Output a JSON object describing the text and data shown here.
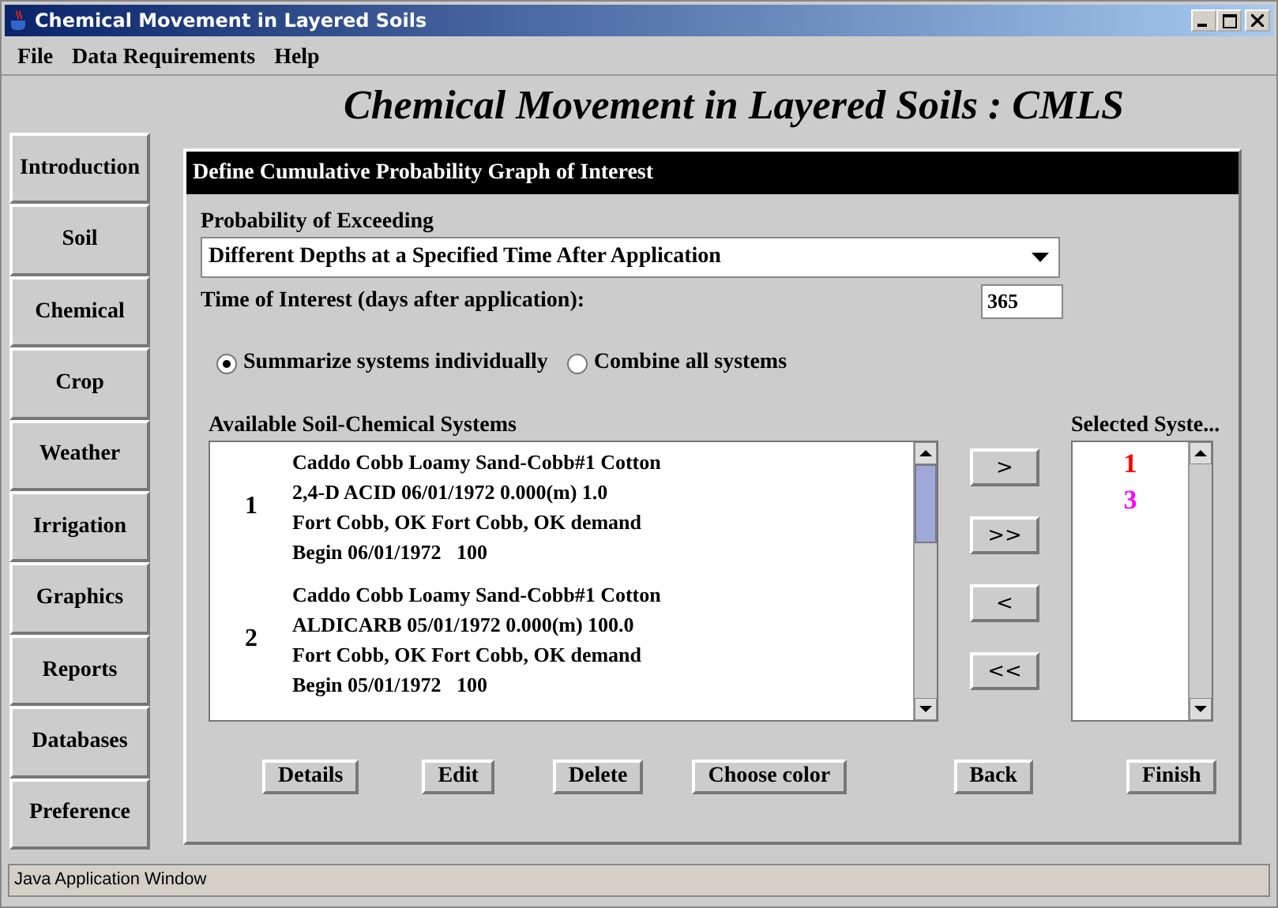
{
  "window": {
    "title": "Chemical Movement in Layered Soils"
  },
  "menu": [
    "File",
    "Data Requirements",
    "Help"
  ],
  "heading": "Chemical Movement in Layered Soils : CMLS",
  "sidebar": {
    "items": [
      "Introduction",
      "Soil",
      "Chemical",
      "Crop",
      "Weather",
      "Irrigation",
      "Graphics",
      "Reports",
      "Databases",
      "Preference"
    ]
  },
  "panel": {
    "title": "Define Cumulative Probability Graph of Interest",
    "probability_label": "Probability of Exceeding",
    "probability_dropdown": {
      "value": "Different Depths at a Specified Time After Application"
    },
    "time_label": "Time of Interest (days after application):",
    "time_field": {
      "value": "365"
    },
    "radios": [
      {
        "label": "Summarize systems individually",
        "selected": true
      },
      {
        "label": "Combine all systems",
        "selected": false
      }
    ],
    "available_label": "Available Soil-Chemical Systems",
    "available": [
      {
        "number": "1",
        "lines": [
          "Caddo Cobb Loamy Sand-Cobb#1 Cotton",
          "2,4-D ACID 06/01/1972 0.000(m) 1.0",
          "Fort Cobb, OK Fort Cobb, OK demand",
          "Begin 06/01/1972   100"
        ]
      },
      {
        "number": "2",
        "lines": [
          "Caddo Cobb Loamy Sand-Cobb#1 Cotton",
          "ALDICARB 05/01/1972 0.000(m) 100.0",
          "Fort Cobb, OK Fort Cobb, OK demand",
          "Begin 05/01/1972   100"
        ]
      }
    ],
    "move_buttons": [
      ">",
      ">>",
      "<",
      "<<"
    ],
    "selected_label": "Selected Syste...",
    "selected": [
      {
        "number": "1",
        "color": "#ff0000"
      },
      {
        "number": "3",
        "color": "#ff00ff"
      }
    ],
    "buttons": [
      "Details",
      "Edit",
      "Delete",
      "Choose color",
      "Back",
      "Finish"
    ]
  },
  "status_bar": "Java Application Window"
}
